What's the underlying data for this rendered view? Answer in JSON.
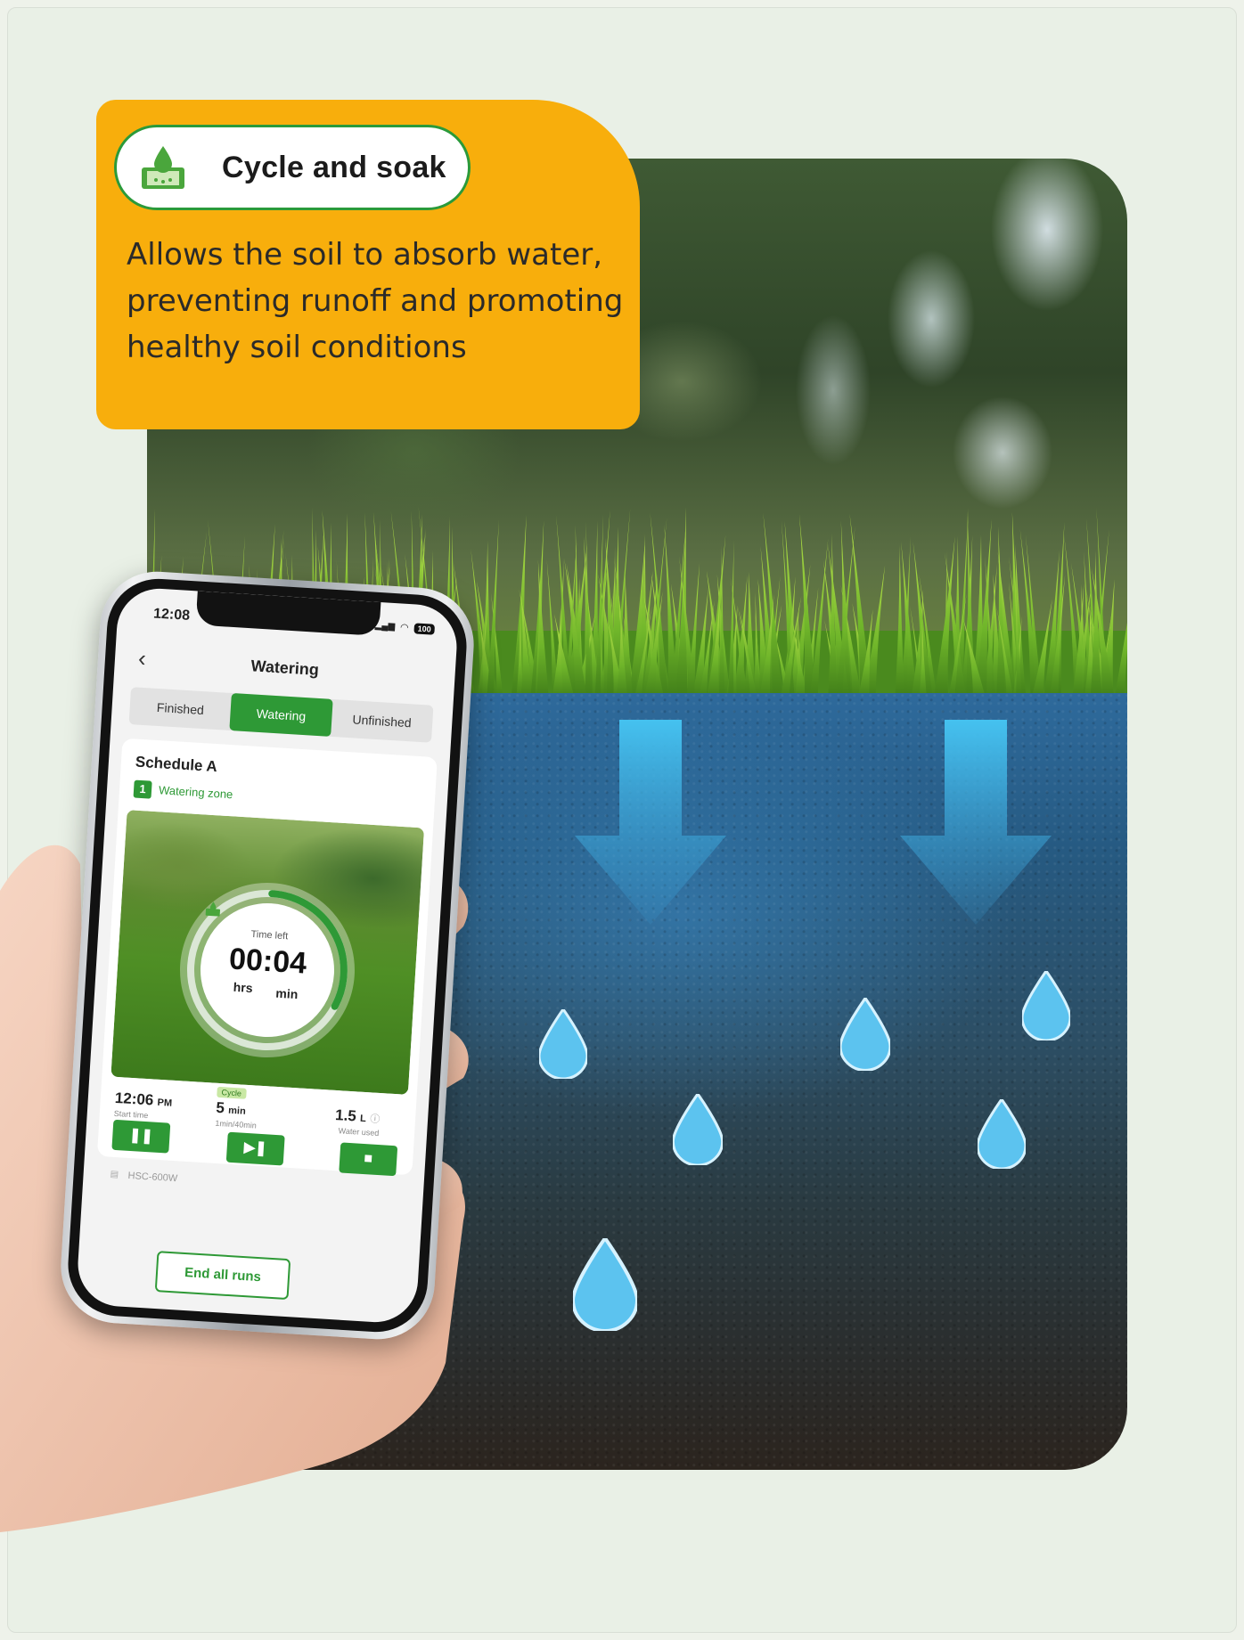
{
  "callout": {
    "title": "Cycle and soak",
    "description": "Allows the soil to absorb water, preventing runoff and promoting healthy soil conditions"
  },
  "phone": {
    "status_time": "12:08",
    "battery": "100",
    "nav_title": "Watering",
    "tabs": [
      {
        "label": "Finished",
        "active": false
      },
      {
        "label": "Watering",
        "active": true
      },
      {
        "label": "Unfinished",
        "active": false
      }
    ],
    "schedule_title": "Schedule A",
    "zone_number": "1",
    "zone_label": "Watering zone",
    "time_left_label": "Time left",
    "time_left_value": "00:04",
    "time_left_hrs": "hrs",
    "time_left_min": "min",
    "start_time": "12:06",
    "start_time_suffix": "PM",
    "start_time_label": "Start time",
    "cycle_tag": "Cycle",
    "cycle_value": "5",
    "cycle_unit": "min",
    "cycle_detail": "1min/40min",
    "water_used_value": "1.5",
    "water_used_unit": "L",
    "water_used_label": "Water used",
    "controls": {
      "pause": "❚❚",
      "skip": "▶❚",
      "stop": "■"
    },
    "device_name": "HSC-600W",
    "end_button": "End all runs"
  },
  "colors": {
    "accent_green": "#2e9936",
    "callout_orange": "#f8ae0c",
    "background": "#e9f0e6"
  }
}
